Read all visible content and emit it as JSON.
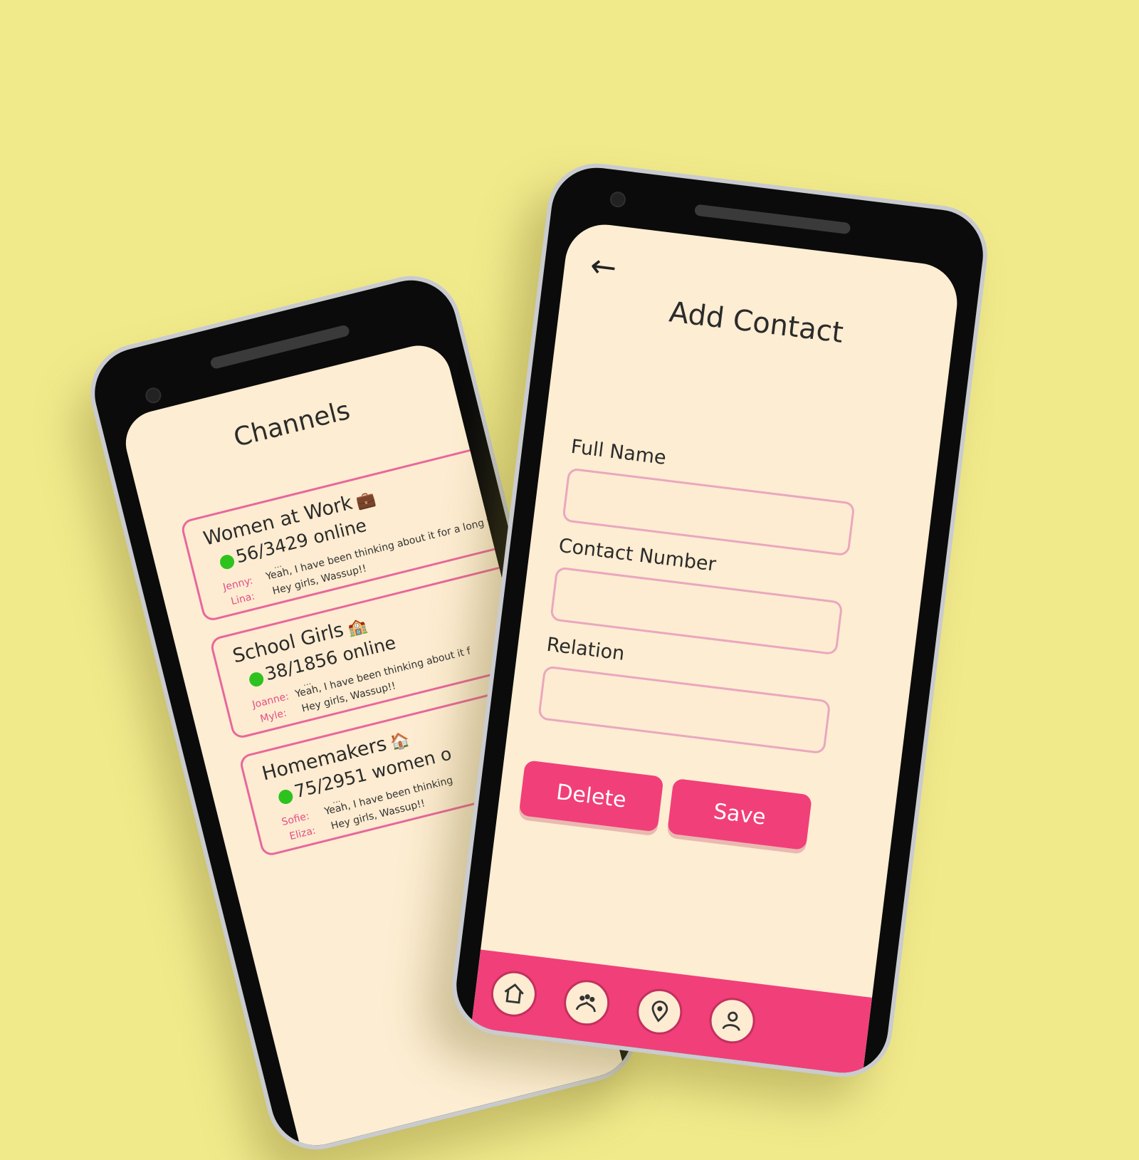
{
  "left_phone": {
    "title": "Channels",
    "channels": [
      {
        "name": "Women at Work",
        "emoji": "💼",
        "online": "56/3429 online",
        "messages": [
          {
            "sender": "Jenny:",
            "text": "Yeah, I have been thinking about it for a long ti"
          },
          {
            "sender": "Lina:",
            "text": "Hey girls, Wassup!!"
          }
        ]
      },
      {
        "name": "School Girls",
        "emoji": "🏫",
        "online": "38/1856 online",
        "messages": [
          {
            "sender": "Joanne:",
            "text": "Yeah, I have been thinking about it f"
          },
          {
            "sender": "Myle:",
            "text": "Hey girls, Wassup!!"
          }
        ]
      },
      {
        "name": "Homemakers",
        "emoji": "🏠",
        "online": "75/2951 women o",
        "messages": [
          {
            "sender": "Sofie:",
            "text": "Yeah, I have been thinking"
          },
          {
            "sender": "Eliza:",
            "text": "Hey girls, Wassup!!"
          }
        ]
      }
    ]
  },
  "right_phone": {
    "back_icon": "←",
    "title": "Add Contact",
    "fields": [
      {
        "label": "Full Name",
        "value": ""
      },
      {
        "label": "Contact Number",
        "value": ""
      },
      {
        "label": "Relation",
        "value": ""
      }
    ],
    "delete_label": "Delete",
    "save_label": "Save"
  },
  "colors": {
    "background": "#f1ea8b",
    "screen": "#fdedd2",
    "accent": "#f13f7a",
    "card_border": "#e9679b",
    "online_dot": "#2ec21f"
  }
}
